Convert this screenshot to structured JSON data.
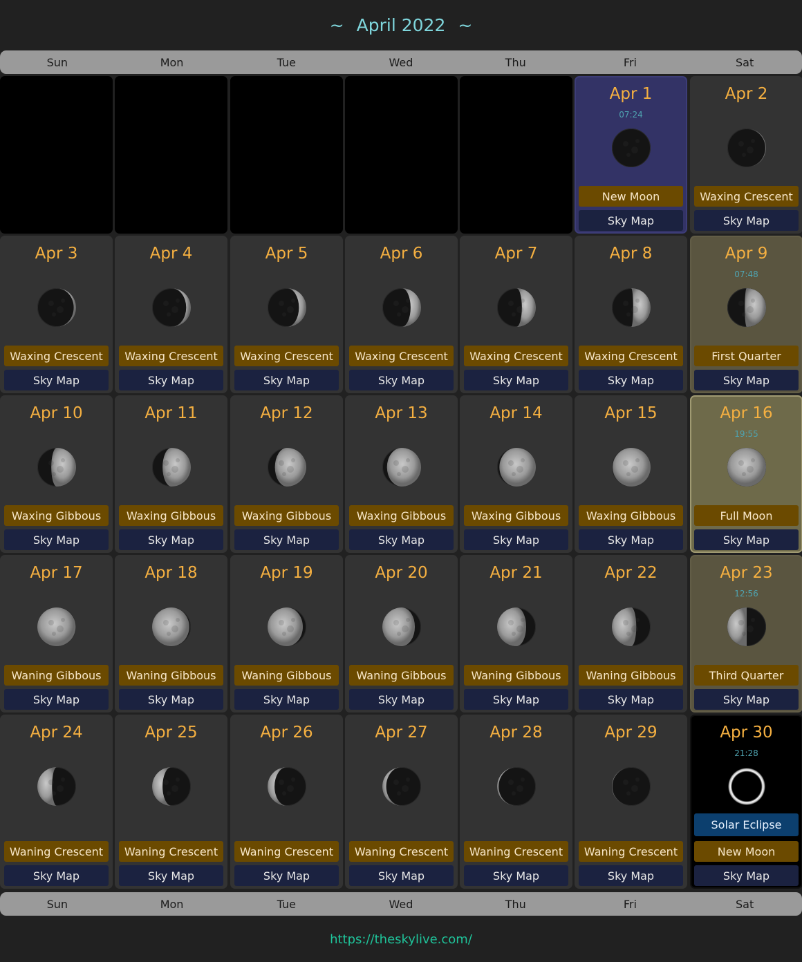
{
  "header": {
    "title": "April 2022",
    "prefix": "~",
    "suffix": "~"
  },
  "weekdays": [
    "Sun",
    "Mon",
    "Tue",
    "Wed",
    "Thu",
    "Fri",
    "Sat"
  ],
  "skymap_label": "Sky Map",
  "footer": {
    "url": "https://theskylive.com/"
  },
  "leading_blank_days": 5,
  "days": [
    {
      "date": "Apr 1",
      "time": "07:24",
      "phase": "New Moon",
      "illum": 0.0,
      "waxing": true,
      "style": "newmoon"
    },
    {
      "date": "Apr 2",
      "time": "",
      "phase": "Waxing Crescent",
      "illum": 0.02,
      "waxing": true,
      "style": ""
    },
    {
      "date": "Apr 3",
      "time": "",
      "phase": "Waxing Crescent",
      "illum": 0.06,
      "waxing": true,
      "style": ""
    },
    {
      "date": "Apr 4",
      "time": "",
      "phase": "Waxing Crescent",
      "illum": 0.12,
      "waxing": true,
      "style": ""
    },
    {
      "date": "Apr 5",
      "time": "",
      "phase": "Waxing Crescent",
      "illum": 0.19,
      "waxing": true,
      "style": ""
    },
    {
      "date": "Apr 6",
      "time": "",
      "phase": "Waxing Crescent",
      "illum": 0.27,
      "waxing": true,
      "style": ""
    },
    {
      "date": "Apr 7",
      "time": "",
      "phase": "Waxing Crescent",
      "illum": 0.36,
      "waxing": true,
      "style": ""
    },
    {
      "date": "Apr 8",
      "time": "",
      "phase": "Waxing Crescent",
      "illum": 0.45,
      "waxing": true,
      "style": ""
    },
    {
      "date": "Apr 9",
      "time": "07:48",
      "phase": "First Quarter",
      "illum": 0.55,
      "waxing": true,
      "style": "quarter"
    },
    {
      "date": "Apr 10",
      "time": "",
      "phase": "Waxing Gibbous",
      "illum": 0.64,
      "waxing": true,
      "style": ""
    },
    {
      "date": "Apr 11",
      "time": "",
      "phase": "Waxing Gibbous",
      "illum": 0.73,
      "waxing": true,
      "style": ""
    },
    {
      "date": "Apr 12",
      "time": "",
      "phase": "Waxing Gibbous",
      "illum": 0.81,
      "waxing": true,
      "style": ""
    },
    {
      "date": "Apr 13",
      "time": "",
      "phase": "Waxing Gibbous",
      "illum": 0.88,
      "waxing": true,
      "style": ""
    },
    {
      "date": "Apr 14",
      "time": "",
      "phase": "Waxing Gibbous",
      "illum": 0.94,
      "waxing": true,
      "style": ""
    },
    {
      "date": "Apr 15",
      "time": "",
      "phase": "Waxing Gibbous",
      "illum": 0.98,
      "waxing": true,
      "style": ""
    },
    {
      "date": "Apr 16",
      "time": "19:55",
      "phase": "Full Moon",
      "illum": 1.0,
      "waxing": true,
      "style": "fullmoon"
    },
    {
      "date": "Apr 17",
      "time": "",
      "phase": "Waning Gibbous",
      "illum": 0.99,
      "waxing": false,
      "style": ""
    },
    {
      "date": "Apr 18",
      "time": "",
      "phase": "Waning Gibbous",
      "illum": 0.96,
      "waxing": false,
      "style": ""
    },
    {
      "date": "Apr 19",
      "time": "",
      "phase": "Waning Gibbous",
      "illum": 0.91,
      "waxing": false,
      "style": ""
    },
    {
      "date": "Apr 20",
      "time": "",
      "phase": "Waning Gibbous",
      "illum": 0.84,
      "waxing": false,
      "style": ""
    },
    {
      "date": "Apr 21",
      "time": "",
      "phase": "Waning Gibbous",
      "illum": 0.75,
      "waxing": false,
      "style": ""
    },
    {
      "date": "Apr 22",
      "time": "",
      "phase": "Waning Gibbous",
      "illum": 0.63,
      "waxing": false,
      "style": ""
    },
    {
      "date": "Apr 23",
      "time": "12:56",
      "phase": "Third Quarter",
      "illum": 0.5,
      "waxing": false,
      "style": "quarter"
    },
    {
      "date": "Apr 24",
      "time": "",
      "phase": "Waning Crescent",
      "illum": 0.38,
      "waxing": false,
      "style": ""
    },
    {
      "date": "Apr 25",
      "time": "",
      "phase": "Waning Crescent",
      "illum": 0.27,
      "waxing": false,
      "style": ""
    },
    {
      "date": "Apr 26",
      "time": "",
      "phase": "Waning Crescent",
      "illum": 0.18,
      "waxing": false,
      "style": ""
    },
    {
      "date": "Apr 27",
      "time": "",
      "phase": "Waning Crescent",
      "illum": 0.1,
      "waxing": false,
      "style": ""
    },
    {
      "date": "Apr 28",
      "time": "",
      "phase": "Waning Crescent",
      "illum": 0.04,
      "waxing": false,
      "style": ""
    },
    {
      "date": "Apr 29",
      "time": "",
      "phase": "Waning Crescent",
      "illum": 0.01,
      "waxing": false,
      "style": ""
    },
    {
      "date": "Apr 30",
      "time": "21:28",
      "phase": "New Moon",
      "illum": 0.0,
      "waxing": true,
      "style": "eclipse",
      "event": "Solar Eclipse"
    }
  ],
  "colors": {
    "title": "#7fd6dc",
    "date": "#f5b041",
    "time": "#4fa3b0",
    "phase_button": "#6b4a00",
    "skymap_button": "#1b2240",
    "eclipse_button": "#0c3f6e",
    "link": "#1fc39a"
  }
}
